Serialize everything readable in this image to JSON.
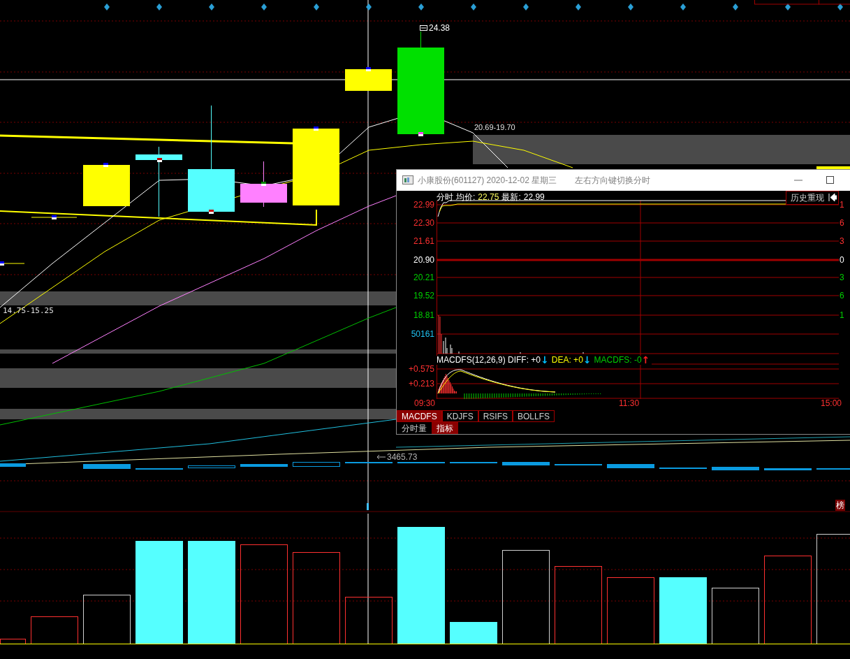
{
  "main_chart": {
    "price_labels": [
      {
        "kind": "high",
        "text": "24.38"
      },
      {
        "kind": "zone",
        "text": "20.69-19.70"
      },
      {
        "kind": "zone_left",
        "text": "14.75-15.25"
      },
      {
        "kind": "index",
        "text": "3465.73"
      }
    ],
    "badge": "榜"
  },
  "popup": {
    "title": "小康股份(601127) 2020-12-02 星期三",
    "hint": "左右方向键切换分时",
    "header": {
      "label": "分时",
      "avg_label": "均价:",
      "avg": "22.75",
      "latest_label": "最新:",
      "latest": "22.99"
    },
    "history_button": "历史重现",
    "price_axis": [
      {
        "text": "22.99",
        "color": "#ff3030"
      },
      {
        "text": "22.30",
        "color": "#ff3030"
      },
      {
        "text": "21.61",
        "color": "#ff3030"
      },
      {
        "text": "20.90",
        "color": "#ffffff"
      },
      {
        "text": "20.21",
        "color": "#00d000"
      },
      {
        "text": "19.52",
        "color": "#00d000"
      },
      {
        "text": "18.81",
        "color": "#00d000"
      }
    ],
    "right_axis": [
      {
        "text": "1",
        "color": "#ff3030"
      },
      {
        "text": "6",
        "color": "#ff3030"
      },
      {
        "text": "3",
        "color": "#ff3030"
      },
      {
        "text": "0",
        "color": "#ffffff"
      },
      {
        "text": "3",
        "color": "#00d000"
      },
      {
        "text": "6",
        "color": "#00d000"
      },
      {
        "text": "1",
        "color": "#00d000"
      }
    ],
    "volume_label": "50161",
    "macd_legend": [
      {
        "kind": "text",
        "text": "MACDFS(12,26,9) DIFF: +0",
        "color": "#ffffff"
      },
      {
        "kind": "arrow",
        "text": "↓",
        "color": "#00c0ff"
      },
      {
        "kind": "text",
        "text": "DEA: +0",
        "color": "#ffff00"
      },
      {
        "kind": "arrow",
        "text": "↓",
        "color": "#00c0ff"
      },
      {
        "kind": "text",
        "text": "MACDFS: -0",
        "color": "#00d000"
      },
      {
        "kind": "arrow",
        "text": "↑",
        "color": "#ff2020"
      }
    ],
    "macd_axis": [
      "+0.575",
      "+0.213"
    ],
    "time_axis": [
      "09:30",
      "11:30",
      "15:00"
    ],
    "indicator_tabs": [
      {
        "label": "MACDFS",
        "selected": true
      },
      {
        "label": "KDJFS",
        "selected": false
      },
      {
        "label": "RSIFS",
        "selected": false
      },
      {
        "label": "BOLLFS",
        "selected": false
      }
    ],
    "bottom_tabs": [
      {
        "label": "分时量",
        "selected": false
      },
      {
        "label": "指标",
        "selected": true
      }
    ]
  }
}
